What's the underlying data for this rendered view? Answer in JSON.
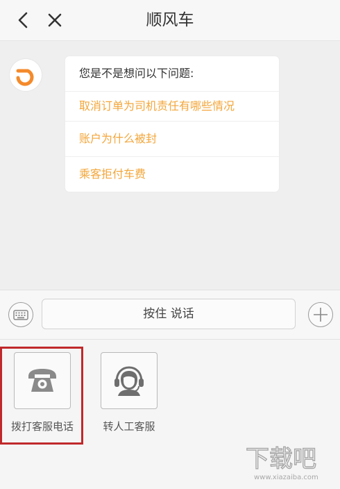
{
  "header": {
    "title": "顺风车",
    "back_icon": "chevron-left-icon",
    "close_icon": "close-icon"
  },
  "chat": {
    "avatar_icon": "didi-logo",
    "prompt": "您是不是想问以下问题:",
    "questions": [
      "取消订单为司机责任有哪些情况",
      "账户为什么被封",
      "乘客拒付车费"
    ],
    "link_color": "#f3a63a"
  },
  "input_bar": {
    "keyboard_icon": "keyboard-icon",
    "talk_label": "按住 说话",
    "plus_icon": "plus-icon"
  },
  "tools": [
    {
      "label": "拨打客服电话",
      "icon": "telephone-icon",
      "highlighted": true
    },
    {
      "label": "转人工客服",
      "icon": "headset-agent-icon",
      "highlighted": false
    }
  ],
  "watermark": {
    "text": "下载吧",
    "url": "www.xiazaiba.com"
  },
  "colors": {
    "accent": "#f3a63a",
    "highlight_border": "#c0292b"
  }
}
